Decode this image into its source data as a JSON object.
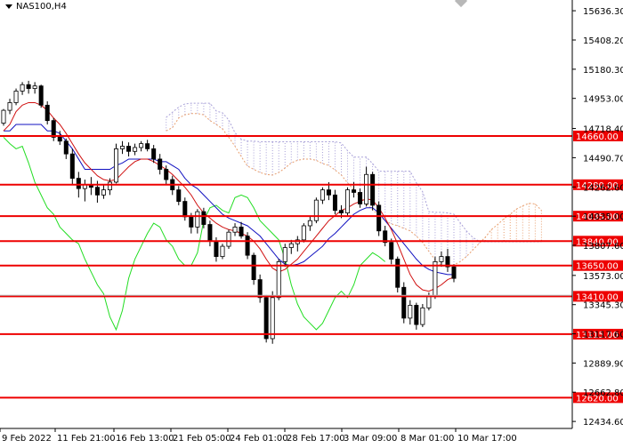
{
  "chart_data": {
    "type": "candlestick",
    "symbol": "NAS100,H4",
    "ylim": [
      12380,
      15720
    ],
    "y_ticks": [
      15636.3,
      15408.2,
      15180.3,
      14953.0,
      14718.4,
      14490.7,
      14262.6,
      14035.0,
      13807.6,
      13573.0,
      13345.3,
      13117.6,
      12889.9,
      12662.8,
      12434.6
    ],
    "x_labels": [
      "9 Feb 2022",
      "11 Feb 21:00",
      "16 Feb 13:00",
      "21 Feb 05:00",
      "24 Feb 01:00",
      "28 Feb 17:00",
      "3 Mar 09:00",
      "8 Mar 01:00",
      "10 Mar 17:00"
    ],
    "levels": [
      {
        "value": 14660,
        "label": "14660.00"
      },
      {
        "value": 14280,
        "label": "14280.00"
      },
      {
        "value": 14035,
        "label": "14035.00"
      },
      {
        "value": 13840,
        "label": "13840.00"
      },
      {
        "value": 13650,
        "label": "13650.00"
      },
      {
        "value": 13410,
        "label": "13410.00"
      },
      {
        "value": 13115,
        "label": "13115.00"
      },
      {
        "value": 12620,
        "label": "12620.00"
      }
    ],
    "current_price": 13418,
    "candles": [
      [
        14760,
        14870,
        14740,
        14860
      ],
      [
        14860,
        14950,
        14830,
        14920
      ],
      [
        14920,
        15030,
        14900,
        15010
      ],
      [
        15010,
        15080,
        14980,
        15060
      ],
      [
        15060,
        15090,
        14990,
        15030
      ],
      [
        15030,
        15080,
        14990,
        15050
      ],
      [
        15050,
        15060,
        14880,
        14900
      ],
      [
        14900,
        14930,
        14750,
        14780
      ],
      [
        14780,
        14800,
        14620,
        14650
      ],
      [
        14650,
        14700,
        14590,
        14620
      ],
      [
        14620,
        14640,
        14480,
        14520
      ],
      [
        14520,
        14560,
        14280,
        14330
      ],
      [
        14330,
        14380,
        14180,
        14250
      ],
      [
        14250,
        14320,
        14150,
        14280
      ],
      [
        14280,
        14340,
        14200,
        14260
      ],
      [
        14260,
        14310,
        14140,
        14200
      ],
      [
        14200,
        14280,
        14170,
        14240
      ],
      [
        14240,
        14330,
        14200,
        14300
      ],
      [
        14300,
        14600,
        14290,
        14560
      ],
      [
        14560,
        14620,
        14520,
        14580
      ],
      [
        14580,
        14610,
        14500,
        14540
      ],
      [
        14540,
        14600,
        14510,
        14570
      ],
      [
        14570,
        14620,
        14540,
        14600
      ],
      [
        14600,
        14630,
        14540,
        14560
      ],
      [
        14560,
        14590,
        14450,
        14480
      ],
      [
        14480,
        14520,
        14360,
        14400
      ],
      [
        14400,
        14430,
        14280,
        14320
      ],
      [
        14320,
        14350,
        14200,
        14240
      ],
      [
        14240,
        14270,
        14120,
        14150
      ],
      [
        14150,
        14180,
        14000,
        14030
      ],
      [
        14030,
        14060,
        13900,
        13950
      ],
      [
        13950,
        14090,
        13900,
        14070
      ],
      [
        14070,
        14100,
        13940,
        13970
      ],
      [
        13970,
        14000,
        13800,
        13840
      ],
      [
        13840,
        13870,
        13680,
        13720
      ],
      [
        13720,
        13820,
        13700,
        13800
      ],
      [
        13800,
        13930,
        13780,
        13910
      ],
      [
        13910,
        13980,
        13880,
        13950
      ],
      [
        13950,
        13990,
        13860,
        13880
      ],
      [
        13880,
        13910,
        13700,
        13730
      ],
      [
        13730,
        13750,
        13500,
        13540
      ],
      [
        13540,
        13580,
        13360,
        13400
      ],
      [
        13400,
        13420,
        13050,
        13080
      ],
      [
        13080,
        13450,
        13040,
        13400
      ],
      [
        13400,
        13700,
        13380,
        13680
      ],
      [
        13680,
        13820,
        13640,
        13790
      ],
      [
        13790,
        13850,
        13740,
        13820
      ],
      [
        13820,
        13880,
        13760,
        13850
      ],
      [
        13850,
        13980,
        13830,
        13960
      ],
      [
        13960,
        14030,
        13920,
        14000
      ],
      [
        14000,
        14180,
        13980,
        14160
      ],
      [
        14160,
        14260,
        14130,
        14240
      ],
      [
        14240,
        14300,
        14160,
        14200
      ],
      [
        14200,
        14240,
        14050,
        14080
      ],
      [
        14080,
        14120,
        14020,
        14060
      ],
      [
        14060,
        14260,
        14040,
        14240
      ],
      [
        14240,
        14300,
        14180,
        14220
      ],
      [
        14220,
        14250,
        14100,
        14130
      ],
      [
        14130,
        14420,
        14110,
        14360
      ],
      [
        14360,
        14380,
        14080,
        14120
      ],
      [
        14120,
        14150,
        13880,
        13920
      ],
      [
        13920,
        13960,
        13800,
        13830
      ],
      [
        13830,
        13860,
        13660,
        13700
      ],
      [
        13700,
        13720,
        13440,
        13480
      ],
      [
        13480,
        13520,
        13200,
        13240
      ],
      [
        13240,
        13380,
        13190,
        13340
      ],
      [
        13340,
        13360,
        13150,
        13190
      ],
      [
        13190,
        13350,
        13170,
        13320
      ],
      [
        13320,
        13440,
        13300,
        13410
      ],
      [
        13410,
        13720,
        13390,
        13680
      ],
      [
        13680,
        13760,
        13640,
        13720
      ],
      [
        13720,
        13780,
        13600,
        13640
      ],
      [
        13640,
        13660,
        13520,
        13550
      ]
    ],
    "tenkan": [
      14700,
      14750,
      14850,
      14900,
      14920,
      14920,
      14900,
      14860,
      14800,
      14750,
      14680,
      14600,
      14520,
      14450,
      14400,
      14350,
      14320,
      14310,
      14320,
      14370,
      14420,
      14460,
      14480,
      14480,
      14460,
      14430,
      14400,
      14360,
      14310,
      14260,
      14200,
      14120,
      14060,
      14020,
      13980,
      13950,
      13930,
      13920,
      13900,
      13880,
      13840,
      13780,
      13700,
      13630,
      13600,
      13620,
      13660,
      13700,
      13760,
      13820,
      13880,
      13940,
      14000,
      14040,
      14080,
      14100,
      14130,
      14150,
      14170,
      14160,
      14100,
      14020,
      13930,
      13820,
      13700,
      13580,
      13500,
      13460,
      13450,
      13470,
      13500,
      13540,
      13560
    ],
    "kijun": [
      14700,
      14700,
      14750,
      14750,
      14750,
      14750,
      14750,
      14700,
      14700,
      14680,
      14620,
      14560,
      14480,
      14400,
      14400,
      14400,
      14400,
      14400,
      14430,
      14450,
      14480,
      14480,
      14480,
      14480,
      14480,
      14460,
      14460,
      14430,
      14400,
      14330,
      14280,
      14250,
      14200,
      14150,
      14100,
      14050,
      14020,
      14000,
      13980,
      13960,
      13920,
      13880,
      13820,
      13760,
      13700,
      13660,
      13650,
      13660,
      13680,
      13720,
      13760,
      13800,
      13860,
      13900,
      13950,
      14000,
      14050,
      14080,
      14100,
      14100,
      14060,
      14000,
      13940,
      13880,
      13820,
      13760,
      13700,
      13650,
      13620,
      13600,
      13590,
      13580,
      13580
    ],
    "chikou": [
      14650,
      14600,
      14560,
      14580,
      14450,
      14300,
      14200,
      14100,
      14050,
      13950,
      13900,
      13850,
      13820,
      13700,
      13600,
      13500,
      13430,
      13250,
      13150,
      13300,
      13550,
      13700,
      13800,
      13900,
      13980,
      13950,
      13850,
      13800,
      13700,
      13650,
      13650,
      13750,
      14000,
      14100,
      14120,
      14080,
      14060,
      14180,
      14200,
      14180,
      14100,
      14000,
      13950,
      13900,
      13850,
      13700,
      13500,
      13350,
      13250,
      13200,
      13150,
      13200,
      13300,
      13400,
      13450,
      13400,
      13500,
      13650,
      13700,
      13750,
      13720,
      13680
    ]
  }
}
